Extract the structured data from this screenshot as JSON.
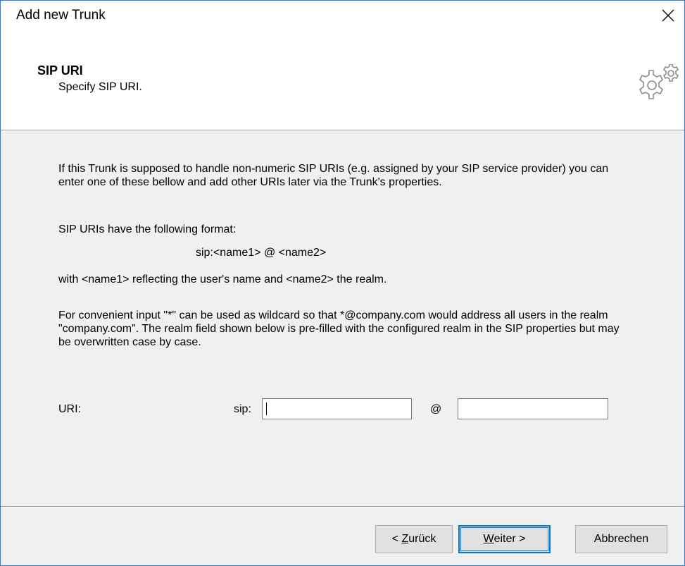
{
  "window": {
    "title": "Add new Trunk"
  },
  "header": {
    "title": "SIP URI",
    "subtitle": "Specify SIP URI."
  },
  "body": {
    "paragraph1": "If this Trunk is supposed to handle non-numeric SIP URIs (e.g. assigned by your SIP service provider) you can enter one of these bellow and add other URIs later via the Trunk's properties.",
    "paragraph2": "SIP URIs have the following format:",
    "format": "sip:<name1> @ <name2>",
    "paragraph3": "with <name1> reflecting the user's name and <name2> the realm.",
    "paragraph4": "For convenient input \"*\" can be used as wildcard so that *@company.com would address all users in the realm \"company.com\". The realm field shown below is pre-filled with the configured realm in the SIP properties but may be overwritten case by case."
  },
  "form": {
    "uri_label": "URI:",
    "sip_prefix": "sip:",
    "at": "@",
    "name_value": "",
    "realm_value": ""
  },
  "buttons": {
    "back_prefix": "< ",
    "back_accel": "Z",
    "back_rest": "urück",
    "next_accel": "W",
    "next_rest": "eiter >",
    "cancel": "Abbrechen"
  },
  "icons": {
    "close": "close-icon",
    "gears": "gears-icon"
  },
  "colors": {
    "window_border": "#2b7fd1",
    "focus_border": "#0078d7",
    "panel_bg": "#f0f0f0"
  }
}
